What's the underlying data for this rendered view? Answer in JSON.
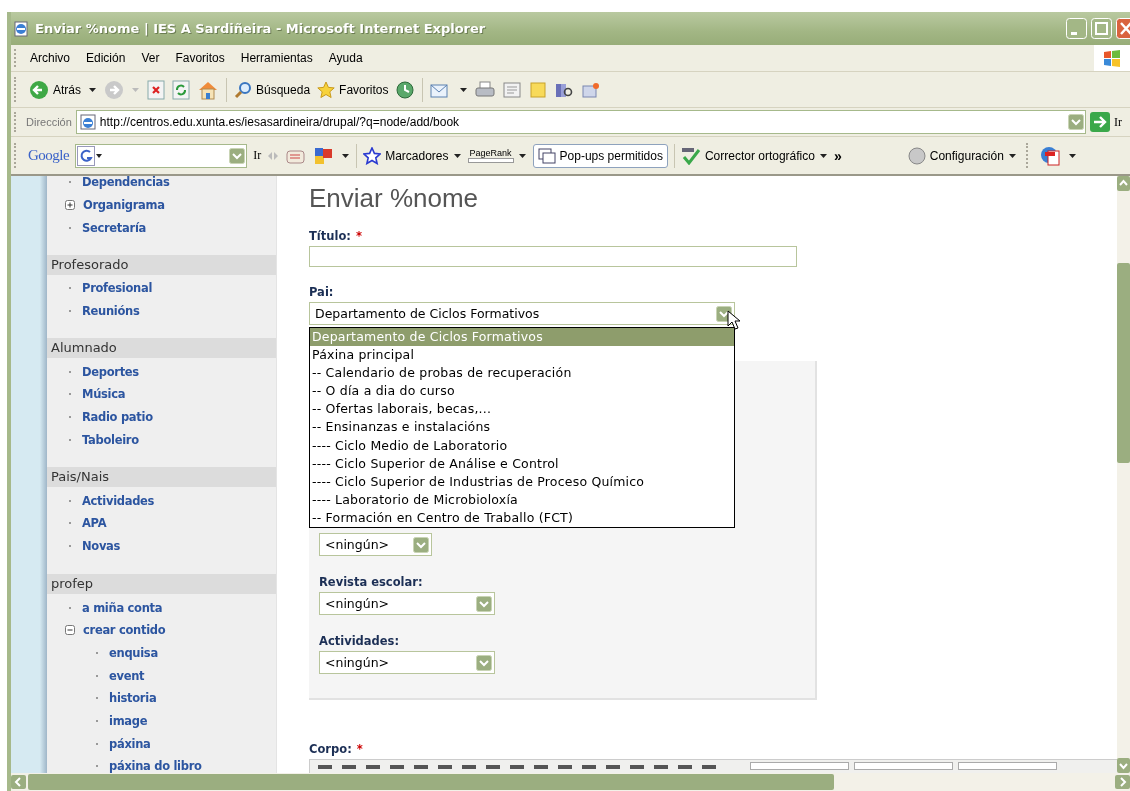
{
  "window": {
    "title": "Enviar %nome | IES A Sardiñeira - Microsoft Internet Explorer"
  },
  "menu": [
    "Archivo",
    "Edición",
    "Ver",
    "Favoritos",
    "Herramientas",
    "Ayuda"
  ],
  "toolbar": {
    "back": "Atrás",
    "search": "Búsqueda",
    "favorites": "Favoritos"
  },
  "address_bar": {
    "label": "Dirección",
    "url": "http://centros.edu.xunta.es/iesasardineira/drupal/?q=node/add/book",
    "go": "Ir"
  },
  "google_toolbar": {
    "logo": "Google",
    "go": "Ir",
    "bookmarks": "Marcadores",
    "pagerank": "PageRank",
    "popups": "Pop-ups permitidos",
    "spellcheck": "Corrector ortográfico",
    "more": "»",
    "settings": "Configuración"
  },
  "sidebar": {
    "sections": [
      {
        "items": [
          {
            "label": "Dependencias",
            "kind": "link"
          },
          {
            "label": "Organigrama",
            "kind": "folder",
            "expanded": false
          },
          {
            "label": "Secretaría",
            "kind": "link"
          }
        ]
      },
      {
        "title": "Profesorado",
        "items": [
          {
            "label": "Profesional",
            "kind": "link"
          },
          {
            "label": "Reunións",
            "kind": "link"
          }
        ]
      },
      {
        "title": "Alumnado",
        "items": [
          {
            "label": "Deportes",
            "kind": "link"
          },
          {
            "label": "Música",
            "kind": "link"
          },
          {
            "label": "Radio patio",
            "kind": "link"
          },
          {
            "label": "Taboleiro",
            "kind": "link"
          }
        ]
      },
      {
        "title": "Pais/Nais",
        "items": [
          {
            "label": "Actividades",
            "kind": "link"
          },
          {
            "label": "APA",
            "kind": "link"
          },
          {
            "label": "Novas",
            "kind": "link"
          }
        ]
      },
      {
        "title": "profep",
        "items": [
          {
            "label": "a miña conta",
            "kind": "link"
          },
          {
            "label": "crear contido",
            "kind": "folder",
            "expanded": true,
            "children": [
              {
                "label": "enquisa",
                "kind": "link"
              },
              {
                "label": "event",
                "kind": "link"
              },
              {
                "label": "historia",
                "kind": "link"
              },
              {
                "label": "image",
                "kind": "link"
              },
              {
                "label": "páxina",
                "kind": "link"
              },
              {
                "label": "páxina do libro",
                "kind": "link"
              }
            ]
          }
        ]
      }
    ]
  },
  "form": {
    "heading": "Enviar %nome",
    "fields": [
      {
        "kind": "text",
        "label": "Título:",
        "required_mark": "*"
      },
      {
        "kind": "select",
        "label": "Pai:",
        "value": "Departamento de Ciclos Formativos",
        "open": true,
        "options": [
          {
            "label": "Departamento de Ciclos Formativos",
            "selected": true
          },
          {
            "label": "Páxina principal",
            "selected": false
          },
          {
            "label": "-- Calendario de probas de recuperación",
            "selected": false
          },
          {
            "label": "-- O día a dia do curso",
            "selected": false
          },
          {
            "label": "-- Ofertas laborais, becas,...",
            "selected": false
          },
          {
            "label": "-- Ensinanzas e instalacións",
            "selected": false
          },
          {
            "label": "---- Ciclo Medio de Laboratorio",
            "selected": false
          },
          {
            "label": "---- Ciclo Superior de Análise e Control",
            "selected": false
          },
          {
            "label": "---- Ciclo Superior de Industrias de Proceso Químico",
            "selected": false
          },
          {
            "label": "---- Laboratorio de Microbioloxía",
            "selected": false
          },
          {
            "label": "-- Formación en Centro de Traballo (FCT)",
            "selected": false
          }
        ]
      }
    ],
    "group": {
      "fields": [
        {
          "kind": "select",
          "value": "<ningún>"
        },
        {
          "kind": "select",
          "label": "Revista escolar:",
          "value": "<ningún>"
        },
        {
          "kind": "select",
          "label": "Actividades:",
          "value": "<ningún>"
        }
      ]
    },
    "body": {
      "label": "Corpo:",
      "required_mark": "*"
    }
  }
}
